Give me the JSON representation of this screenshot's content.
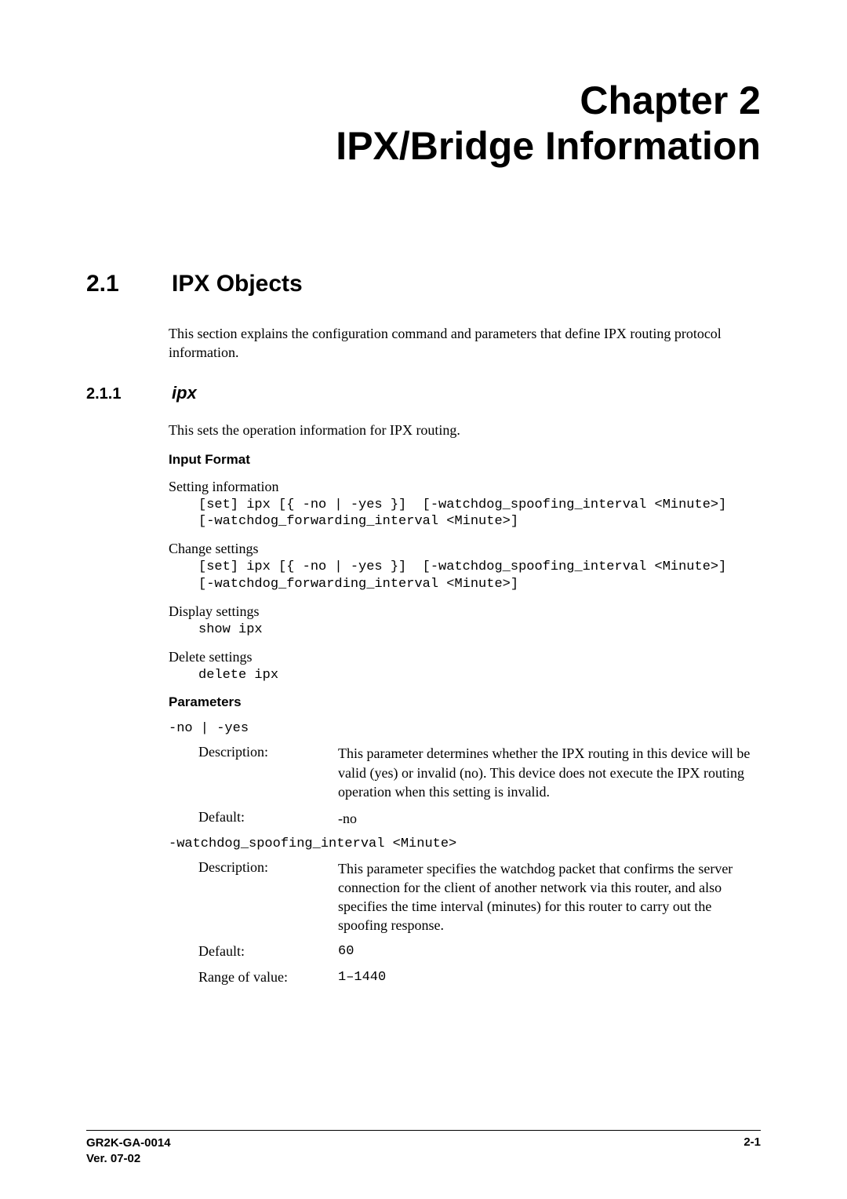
{
  "chapter": {
    "line1": "Chapter 2",
    "line2": "IPX/Bridge Information"
  },
  "section": {
    "num": "2.1",
    "title": "IPX Objects",
    "intro": "This section explains the configuration command and parameters that define IPX routing protocol information."
  },
  "subsection": {
    "num": "2.1.1",
    "title": "ipx",
    "intro": "This sets the operation information for IPX routing."
  },
  "input_format": {
    "heading": "Input Format",
    "blocks": [
      {
        "label": "Setting information",
        "code": "[set] ipx [{ -no | -yes }]  [-watchdog_spoofing_interval <Minute>]\n[-watchdog_forwarding_interval <Minute>]"
      },
      {
        "label": "Change settings",
        "code": "[set] ipx [{ -no | -yes }]  [-watchdog_spoofing_interval <Minute>]\n[-watchdog_forwarding_interval <Minute>]"
      },
      {
        "label": "Display settings",
        "code": "show ipx"
      },
      {
        "label": "Delete settings",
        "code": "delete ipx"
      }
    ]
  },
  "parameters": {
    "heading": "Parameters",
    "items": [
      {
        "flag": "-no | -yes",
        "rows": [
          {
            "key": "Description:",
            "val": "This parameter determines whether the IPX routing in this device will be valid (yes) or invalid (no). This device does not execute the IPX routing operation when this setting is invalid.",
            "code": false
          },
          {
            "key": "Default:",
            "val": "-no",
            "code": false
          }
        ]
      },
      {
        "flag": "-watchdog_spoofing_interval <Minute>",
        "rows": [
          {
            "key": "Description:",
            "val": "This parameter specifies the watchdog packet that confirms the server connection for the client of another network via this router, and also specifies the time interval (minutes) for this router to carry out the spoofing response.",
            "code": false
          },
          {
            "key": "Default:",
            "val": "60",
            "code": true
          },
          {
            "key": "Range of value:",
            "val": "1–1440",
            "code": true
          }
        ]
      }
    ]
  },
  "footer": {
    "left1": "GR2K-GA-0014",
    "left2": "Ver. 07-02",
    "right": "2-1"
  }
}
